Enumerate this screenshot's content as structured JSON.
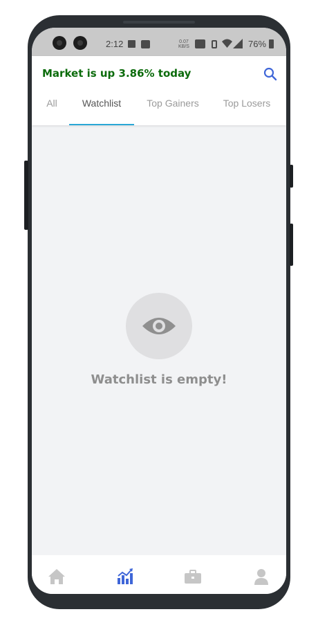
{
  "status_bar": {
    "time": "2:12",
    "speed_value": "0.07",
    "speed_unit": "KB/S",
    "battery": "76%"
  },
  "header": {
    "title": "Market is up 3.86% today",
    "title_color": "#0b6b0b",
    "search_icon": "search-icon",
    "accent_color": "#3f66d8"
  },
  "tabs": [
    {
      "label": "All",
      "active": false
    },
    {
      "label": "Watchlist",
      "active": true
    },
    {
      "label": "Top Gainers",
      "active": false
    },
    {
      "label": "Top Losers",
      "active": false
    }
  ],
  "tab_indicator_color": "#2aa7d6",
  "empty_state": {
    "icon": "eye-icon",
    "message": "Watchlist is empty!"
  },
  "bottom_nav": {
    "items": [
      {
        "icon": "home-icon",
        "active": false
      },
      {
        "icon": "chart-icon",
        "active": true
      },
      {
        "icon": "briefcase-icon",
        "active": false
      },
      {
        "icon": "profile-icon",
        "active": false
      }
    ],
    "active_color": "#3f66d8",
    "inactive_color": "#c6c6c6"
  }
}
